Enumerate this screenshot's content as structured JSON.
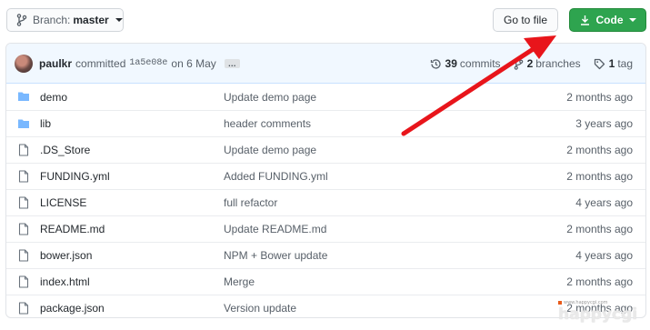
{
  "branch_button": {
    "prefix": "Branch:",
    "name": "master"
  },
  "goto_file_label": "Go to file",
  "code_button_label": "Code",
  "commit": {
    "author": "paulkr",
    "verb": "committed",
    "sha": "1a5e08e",
    "date": "on 6 May",
    "ellipsis": "…"
  },
  "stats": {
    "commits": {
      "num": "39",
      "label": "commits"
    },
    "branches": {
      "num": "2",
      "label": "branches"
    },
    "tags": {
      "num": "1",
      "label": "tag"
    }
  },
  "files": [
    {
      "type": "dir",
      "name": "demo",
      "message": "Update demo page",
      "age": "2 months ago"
    },
    {
      "type": "dir",
      "name": "lib",
      "message": "header comments",
      "age": "3 years ago"
    },
    {
      "type": "file",
      "name": ".DS_Store",
      "message": "Update demo page",
      "age": "2 months ago"
    },
    {
      "type": "file",
      "name": "FUNDING.yml",
      "message": "Added FUNDING.yml",
      "age": "2 months ago"
    },
    {
      "type": "file",
      "name": "LICENSE",
      "message": "full refactor",
      "age": "4 years ago"
    },
    {
      "type": "file",
      "name": "README.md",
      "message": "Update README.md",
      "age": "2 months ago"
    },
    {
      "type": "file",
      "name": "bower.json",
      "message": "NPM + Bower update",
      "age": "4 years ago"
    },
    {
      "type": "file",
      "name": "index.html",
      "message": "Merge",
      "age": "2 months ago"
    },
    {
      "type": "file",
      "name": "package.json",
      "message": "Version update",
      "age": "2 months ago"
    }
  ],
  "watermark": {
    "small": "www.happycgi.com",
    "big": "happycgi"
  },
  "colors": {
    "accent_green": "#2ea44f",
    "folder_blue": "#79b8ff",
    "arrow_red": "#e8151b"
  },
  "icons": {
    "branch": "git-branch-icon",
    "download": "download-icon",
    "history": "history-icon",
    "tag": "tag-icon",
    "folder": "folder-icon",
    "file": "file-icon"
  }
}
